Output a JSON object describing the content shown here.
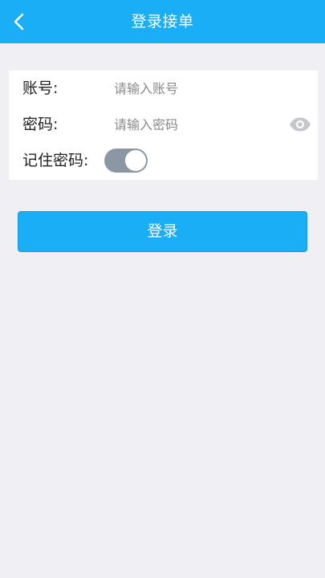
{
  "navbar": {
    "title": "登录接单",
    "back_icon": "chevron-left-icon",
    "background": "#19aef5"
  },
  "form": {
    "account": {
      "label": "账号:",
      "placeholder": "请输入账号",
      "value": ""
    },
    "password": {
      "label": "密码:",
      "placeholder": "请输入密码",
      "value": "",
      "visibility_icon": "eye-icon"
    },
    "remember": {
      "label": "记住密码:",
      "enabled": true
    }
  },
  "login_button": {
    "label": "登录",
    "color": "#19aef5"
  }
}
